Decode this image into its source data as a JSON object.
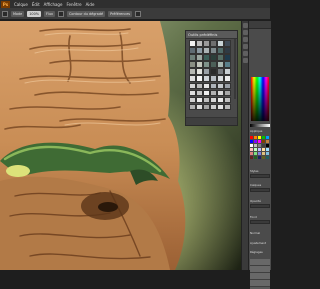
{
  "app": {
    "logo": "Ps"
  },
  "menubar": {
    "items": [
      "Calque",
      "Édit",
      "Affichage",
      "Fenêtre",
      "Aide"
    ]
  },
  "options_bar": {
    "field_1": "Mode",
    "field_2": "100%",
    "field_3": "Flux",
    "field_4": "Contour du dégradé",
    "field_5": "Préférences"
  },
  "swatches_panel": {
    "title": "Outils prédéfinis",
    "colors": [
      "#f2f2f2",
      "#bdbdbd",
      "#9a9a9a",
      "#6f6f6f",
      "#c8d3d6",
      "#3f4b57",
      "#5f6b73",
      "#8c9aa3",
      "#aab2b4",
      "#7e8a8d",
      "#4f6a68",
      "#2f3a44",
      "#6d7f79",
      "#9aa6a0",
      "#3b5e58",
      "#2b3f3a",
      "#536b62",
      "#1f3a4c",
      "#8a8f84",
      "#c1c5bb",
      "#7e928a",
      "#4c5f58",
      "#a7b7b1",
      "#5a7f8a",
      "#b7b9b3",
      "#e3e3de",
      "#9aa0a6",
      "#2b2b2b",
      "#767a7e",
      "#c9cfd3",
      "#dedede",
      "#f5f5f5",
      "#cfd3d7",
      "#b8bec4",
      "#d9dcdf",
      "#ececec",
      "#d4d4d4",
      "#bcbcbc",
      "#e7e7e7",
      "#adb3ba",
      "#c4c8cc",
      "#9aa0a8",
      "#e0e0e0",
      "#c7c7c7",
      "#f0f0f0",
      "#b3b3b3",
      "#dadada",
      "#a9a9a9",
      "#cfcfcf",
      "#ebebeb",
      "#bfbfbf",
      "#d6d6d6",
      "#e9e9e9",
      "#c2c2c2",
      "#b0b0b0",
      "#dcdcdc",
      "#a4a4a4",
      "#cdcdcd",
      "#e4e4e4",
      "#b9b9b9"
    ]
  },
  "right_panel": {
    "labels": [
      "Applique",
      "Styles",
      "Calques",
      "Opacité",
      "Fond",
      "Normal",
      "Ajustement",
      "Réglages"
    ],
    "swatch_colors": [
      "#ff0000",
      "#ff8000",
      "#ffff00",
      "#00c000",
      "#00a0ff",
      "#0000ff",
      "#8000ff",
      "#ff00ff",
      "#804000",
      "#c08040",
      "#ffffff",
      "#c0c0c0",
      "#808080",
      "#404040",
      "#000000",
      "#ffc0c0",
      "#c0ffc0",
      "#c0c0ff",
      "#ffe0a0",
      "#a0e0ff",
      "#e08080",
      "#80e080",
      "#8080e0",
      "#e0c080",
      "#80c0e0",
      "#602020",
      "#206020",
      "#202060",
      "#606020",
      "#206060"
    ]
  }
}
